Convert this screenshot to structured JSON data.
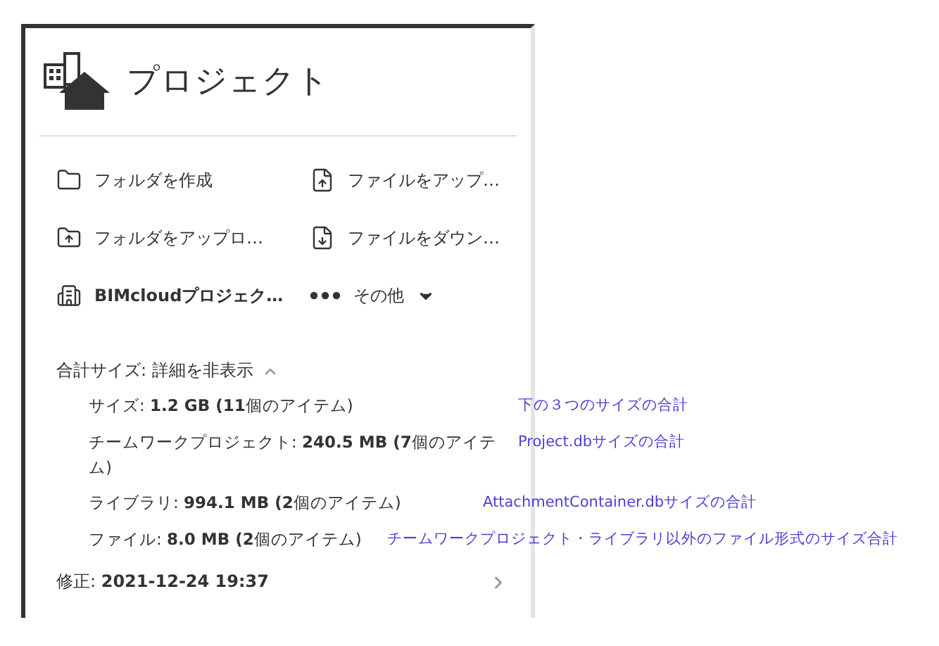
{
  "header": {
    "title": "プロジェクト"
  },
  "actions": [
    {
      "label": "フォルダを作成",
      "kind": "action"
    },
    {
      "label": "ファイルをアップ…",
      "kind": "action"
    },
    {
      "label": "フォルダをアップロ…",
      "kind": "action"
    },
    {
      "label": "ファイルをダウン…",
      "kind": "action"
    },
    {
      "label": "BIMcloudプロジェク…",
      "kind": "strong"
    },
    {
      "label": "その他",
      "kind": "menu"
    }
  ],
  "total_size": {
    "label": "合計サイズ: 詳細を非表示",
    "expanded": true
  },
  "sizes": [
    {
      "text": "サイズ: **1.2 GB (11**個のアイテム)",
      "note": "下の３つのサイズの合計"
    },
    {
      "text": "チームワークプロジェクト: **240.5 MB (7**個のアイテム)",
      "note": "Project.dbサイズの合計"
    },
    {
      "text": "ライブラリ: **994.1 MB (2**個のアイテム)",
      "note": "AttachmentContainer.dbサイズの合計"
    },
    {
      "text": "ファイル: **8.0 MB (2**個のアイテム)",
      "note": "チームワークプロジェクト・ライブラリ以外のファイル形式のサイズ合計"
    }
  ],
  "modified": {
    "text": "修正: **2021-12-24 19:37**"
  }
}
